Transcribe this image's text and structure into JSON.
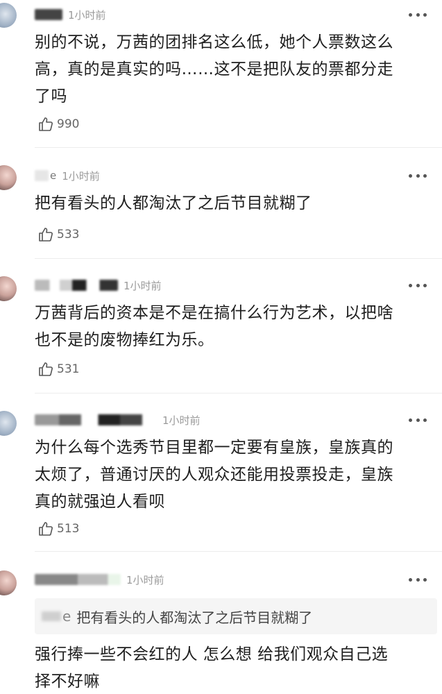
{
  "comments": [
    {
      "time": "1小时前",
      "text_lines": [
        "别的不说，万茜的团排名这么低，她个人票数这么",
        "高，真的是真实的吗……这不是把队友的票都分走",
        "了吗"
      ],
      "likes": "990"
    },
    {
      "name_suffix": "e",
      "time": "1小时前",
      "text_lines": [
        "把有看头的人都淘汰了之后节目就糊了"
      ],
      "likes": "533"
    },
    {
      "time": "1小时前",
      "text_lines": [
        "万茜背后的资本是不是在搞什么行为艺术，以把啥",
        "也不是的废物捧红为乐。"
      ],
      "likes": "531"
    },
    {
      "time": "1小时前",
      "text_lines": [
        "为什么每个选秀节目里都一定要有皇族，皇族真的",
        "太烦了，普通讨厌的人观众还能用投票投走，皇族",
        "真的就强迫人看呗"
      ],
      "likes": "513"
    },
    {
      "time": "1小时前",
      "quote": {
        "name_suffix": "e",
        "text": "把有看头的人都淘汰了之后节目就糊了"
      },
      "text_lines": [
        "强行捧一些不会红的人 怎么想 给我们观众自己选",
        "择不好嘛"
      ]
    }
  ],
  "icons": {
    "like": "thumbs-up-icon",
    "more": "more-dots-icon"
  },
  "colors": {
    "text": "#1e1e1e",
    "meta": "#9a9a9a",
    "divider": "#ececec",
    "quote_bg": "#f5f5f5"
  }
}
